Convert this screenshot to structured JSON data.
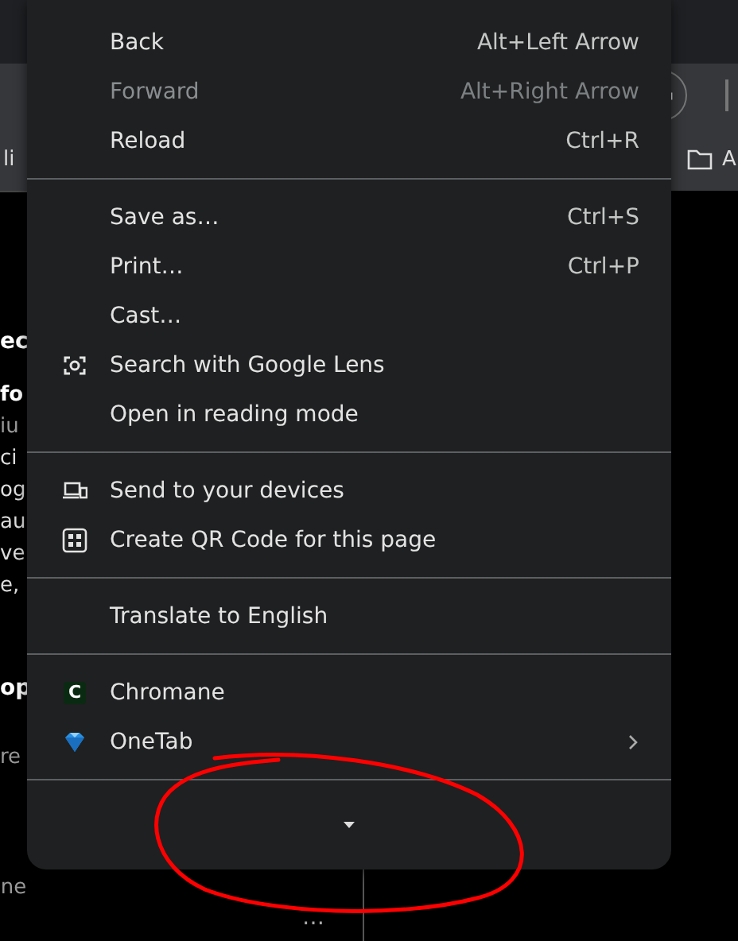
{
  "background": {
    "bookmark_fragment": "li",
    "bookmark_right": "A",
    "left_fragments": [
      {
        "text": "ec",
        "kind": "heading"
      },
      {
        "text": "fo",
        "kind": "subheading"
      },
      {
        "text": "iu",
        "kind": "muted"
      },
      {
        "text": "ci",
        "kind": "body"
      },
      {
        "text": "og",
        "kind": "body"
      },
      {
        "text": "au",
        "kind": "body"
      },
      {
        "text": "ve",
        "kind": "body"
      },
      {
        "text": "e,",
        "kind": "body"
      },
      {
        "text": "op",
        "kind": "heading"
      },
      {
        "text": "re",
        "kind": "muted"
      },
      {
        "text": "ne",
        "kind": "footer"
      }
    ],
    "more": "⋯"
  },
  "menu": {
    "sections": [
      {
        "items": [
          {
            "label": "Back",
            "shortcut": "Alt+Left Arrow",
            "disabled": false,
            "submenu": false
          },
          {
            "label": "Forward",
            "shortcut": "Alt+Right Arrow",
            "disabled": true,
            "submenu": false
          },
          {
            "label": "Reload",
            "shortcut": "Ctrl+R",
            "disabled": false,
            "submenu": false
          }
        ]
      },
      {
        "items": [
          {
            "label": "Save as…",
            "shortcut": "Ctrl+S",
            "disabled": false,
            "submenu": false
          },
          {
            "label": "Print…",
            "shortcut": "Ctrl+P",
            "disabled": false,
            "submenu": false
          },
          {
            "label": "Cast…",
            "disabled": false,
            "submenu": false
          },
          {
            "label": "Search with Google Lens",
            "kind": "lens",
            "disabled": false,
            "submenu": false
          },
          {
            "label": "Open in reading mode",
            "disabled": false,
            "submenu": false
          }
        ]
      },
      {
        "items": [
          {
            "label": "Send to your devices",
            "kind": "devices",
            "disabled": false,
            "submenu": false
          },
          {
            "label": "Create QR Code for this page",
            "kind": "qr",
            "disabled": false,
            "submenu": false
          }
        ]
      },
      {
        "items": [
          {
            "label": "Translate to English",
            "disabled": false,
            "submenu": false
          }
        ]
      },
      {
        "items": [
          {
            "label": "Chromane",
            "kind": "letter-tile",
            "icon_letter": "C",
            "disabled": false,
            "submenu": false
          },
          {
            "label": "OneTab",
            "kind": "gem",
            "disabled": false,
            "submenu": true
          }
        ]
      }
    ]
  }
}
